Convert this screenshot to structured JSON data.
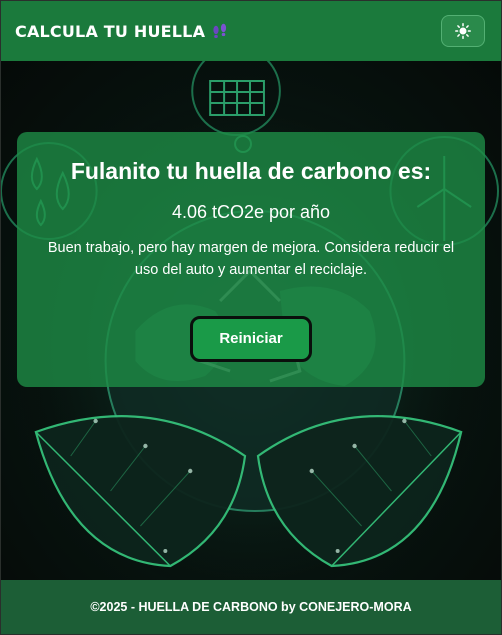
{
  "header": {
    "title": "CALCULA TU HUELLA",
    "brand_icon": "footprints-icon",
    "theme_toggle_icon": "sun-icon"
  },
  "result": {
    "heading": "Fulanito tu huella de carbono es:",
    "value": "4.06 tCO2e por año",
    "message": "Buen trabajo, pero hay margen de mejora. Considera reducir el uso del auto y aumentar el reciclaje.",
    "reset_label": "Reiniciar"
  },
  "footer": {
    "text": "©2025 - HUELLA DE CARBONO by CONEJERO-MORA"
  },
  "colors": {
    "header": "#1b7a3c",
    "card": "#1e8c46",
    "button": "#1a9a48",
    "footer": "#1c5e36",
    "accent_glow": "#2ecc71"
  }
}
